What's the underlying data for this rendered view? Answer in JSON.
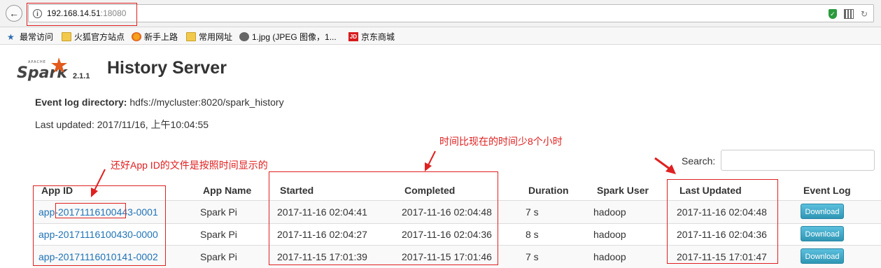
{
  "browser": {
    "url_host": "192.168.14.51",
    "url_port": ":18080",
    "info_icon": "info-icon",
    "back_icon": "back-arrow-icon",
    "bookmarks": [
      {
        "label": "最常访问",
        "icon": "folder-icon"
      },
      {
        "label": "火狐官方站点",
        "icon": "folder-icon"
      },
      {
        "label": "新手上路",
        "icon": "firefox-icon"
      },
      {
        "label": "常用网址",
        "icon": "folder-icon"
      },
      {
        "label": "1.jpg (JPEG 图像，1...",
        "icon": "globe-icon"
      },
      {
        "label": "京东商城",
        "icon": "jd-icon"
      }
    ]
  },
  "page": {
    "version": "2.1.1",
    "title": "History Server",
    "event_log_label": "Event log directory:",
    "event_log_value": "hdfs://mycluster:8020/spark_history",
    "last_updated_label": "Last updated:",
    "last_updated_value": "2017/11/16, 上午10:04:55",
    "search_label": "Search:",
    "search_value": ""
  },
  "table": {
    "headers": {
      "app_id": "App ID",
      "app_name": "App Name",
      "started": "Started",
      "completed": "Completed",
      "duration": "Duration",
      "spark_user": "Spark User",
      "last_updated": "Last Updated",
      "event_log": "Event Log"
    },
    "rows": [
      {
        "app_id": "app-20171116100443-0001",
        "app_name": "Spark Pi",
        "started": "2017-11-16 02:04:41",
        "completed": "2017-11-16 02:04:48",
        "duration": "7 s",
        "user": "hadoop",
        "last_updated": "2017-11-16 02:04:48",
        "download": "Download"
      },
      {
        "app_id": "app-20171116100430-0000",
        "app_name": "Spark Pi",
        "started": "2017-11-16 02:04:27",
        "completed": "2017-11-16 02:04:36",
        "duration": "8 s",
        "user": "hadoop",
        "last_updated": "2017-11-16 02:04:36",
        "download": "Download"
      },
      {
        "app_id": "app-20171116010141-0002",
        "app_name": "Spark Pi",
        "started": "2017-11-15 17:01:39",
        "completed": "2017-11-15 17:01:46",
        "duration": "7 s",
        "user": "hadoop",
        "last_updated": "2017-11-15 17:01:47",
        "download": "Download"
      }
    ]
  },
  "annotations": {
    "app_id_note": "还好App ID的文件是按照时间显示的",
    "time_note": "时间比现在的时间少8个小时",
    "color": "#e02020"
  },
  "colors": {
    "link": "#1f73b7",
    "download_button": "#5bc0de",
    "spark_orange": "#e25a1c"
  }
}
